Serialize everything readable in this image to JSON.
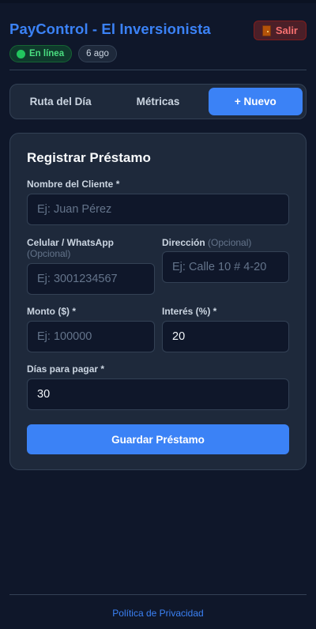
{
  "header": {
    "title": "PayControl - El Inversionista",
    "exit_label": "Salir",
    "status_label": "En línea",
    "version_label": "6 ago"
  },
  "tabs": [
    {
      "label": "Ruta del Día",
      "active": false
    },
    {
      "label": "Métricas",
      "active": false
    },
    {
      "label": "+ Nuevo",
      "active": true
    }
  ],
  "form": {
    "title": "Registrar Préstamo",
    "client_name": {
      "label": "Nombre del Cliente *",
      "placeholder": "Ej: Juan Pérez",
      "value": ""
    },
    "phone": {
      "label": "Celular / WhatsApp",
      "optional": "(Opcional)",
      "placeholder": "Ej: 3001234567",
      "value": ""
    },
    "address": {
      "label": "Dirección",
      "optional": "(Opcional)",
      "placeholder": "Ej: Calle 10 # 4-20",
      "value": ""
    },
    "amount": {
      "label": "Monto ($) *",
      "placeholder": "Ej: 100000",
      "value": ""
    },
    "interest": {
      "label": "Interés (%) *",
      "value": "20"
    },
    "days": {
      "label": "Días para pagar *",
      "value": "30"
    },
    "submit_label": "Guardar Préstamo"
  },
  "footer": {
    "privacy_label": "Política de Privacidad"
  },
  "colors": {
    "background": "#0f172a",
    "card": "#1e293b",
    "accent": "#3b82f6",
    "danger": "#f87171",
    "success": "#4ade80"
  },
  "icons": {
    "exit": "door-icon",
    "status": "green-dot-icon"
  }
}
